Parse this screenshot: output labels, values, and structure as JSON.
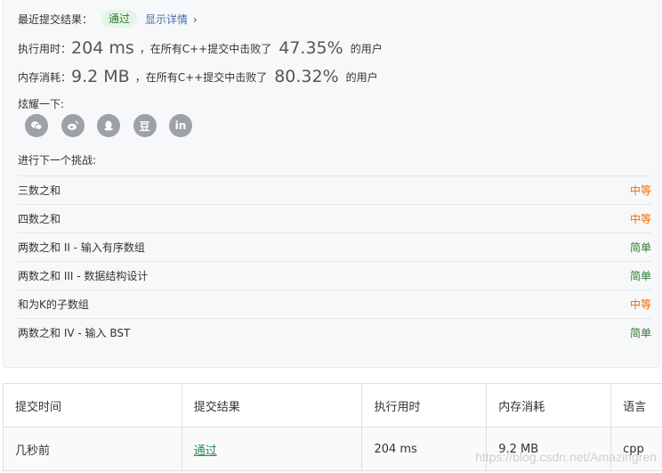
{
  "summary": {
    "result_label": "最近提交结果：",
    "result_badge": "通过",
    "details_link": "显示详情",
    "details_chevron": "›",
    "runtime": {
      "label": "执行用时：",
      "value": "204 ms",
      "middle": "，在所有C++提交中击败了",
      "percent": "47.35%",
      "suffix": "的用户"
    },
    "memory": {
      "label": "内存消耗：",
      "value": "9.2 MB",
      "middle": "，在所有C++提交中击败了",
      "percent": "80.32%",
      "suffix": "的用户"
    },
    "share_label": "炫耀一下:",
    "share_icons": [
      "wechat-icon",
      "weibo-icon",
      "qq-icon",
      "douban-icon",
      "linkedin-icon"
    ],
    "douban_glyph": "豆",
    "linkedin_glyph": "in",
    "next_label": "进行下一个挑战:"
  },
  "challenges": [
    {
      "title": "三数之和",
      "difficulty": "中等",
      "level": "medium"
    },
    {
      "title": "四数之和",
      "difficulty": "中等",
      "level": "medium"
    },
    {
      "title": "两数之和 II - 输入有序数组",
      "difficulty": "简单",
      "level": "easy"
    },
    {
      "title": "两数之和 III - 数据结构设计",
      "difficulty": "简单",
      "level": "easy"
    },
    {
      "title": "和为K的子数组",
      "difficulty": "中等",
      "level": "medium"
    },
    {
      "title": "两数之和 IV - 输入 BST",
      "difficulty": "简单",
      "level": "easy"
    }
  ],
  "submissions": {
    "headers": [
      "提交时间",
      "提交结果",
      "执行用时",
      "内存消耗",
      "语言"
    ],
    "rows": [
      {
        "time": "几秒前",
        "result": "通过",
        "runtime": "204 ms",
        "memory": "9.2 MB",
        "language": "cpp"
      }
    ]
  },
  "watermark": "https://blog.csdn.net/Amazingren",
  "colors": {
    "medium": "#ef6c00",
    "easy": "#2e7d32",
    "badge_bg": "#e6f5e9",
    "badge_text": "#2e7d32",
    "link": "#4a6fa5"
  }
}
